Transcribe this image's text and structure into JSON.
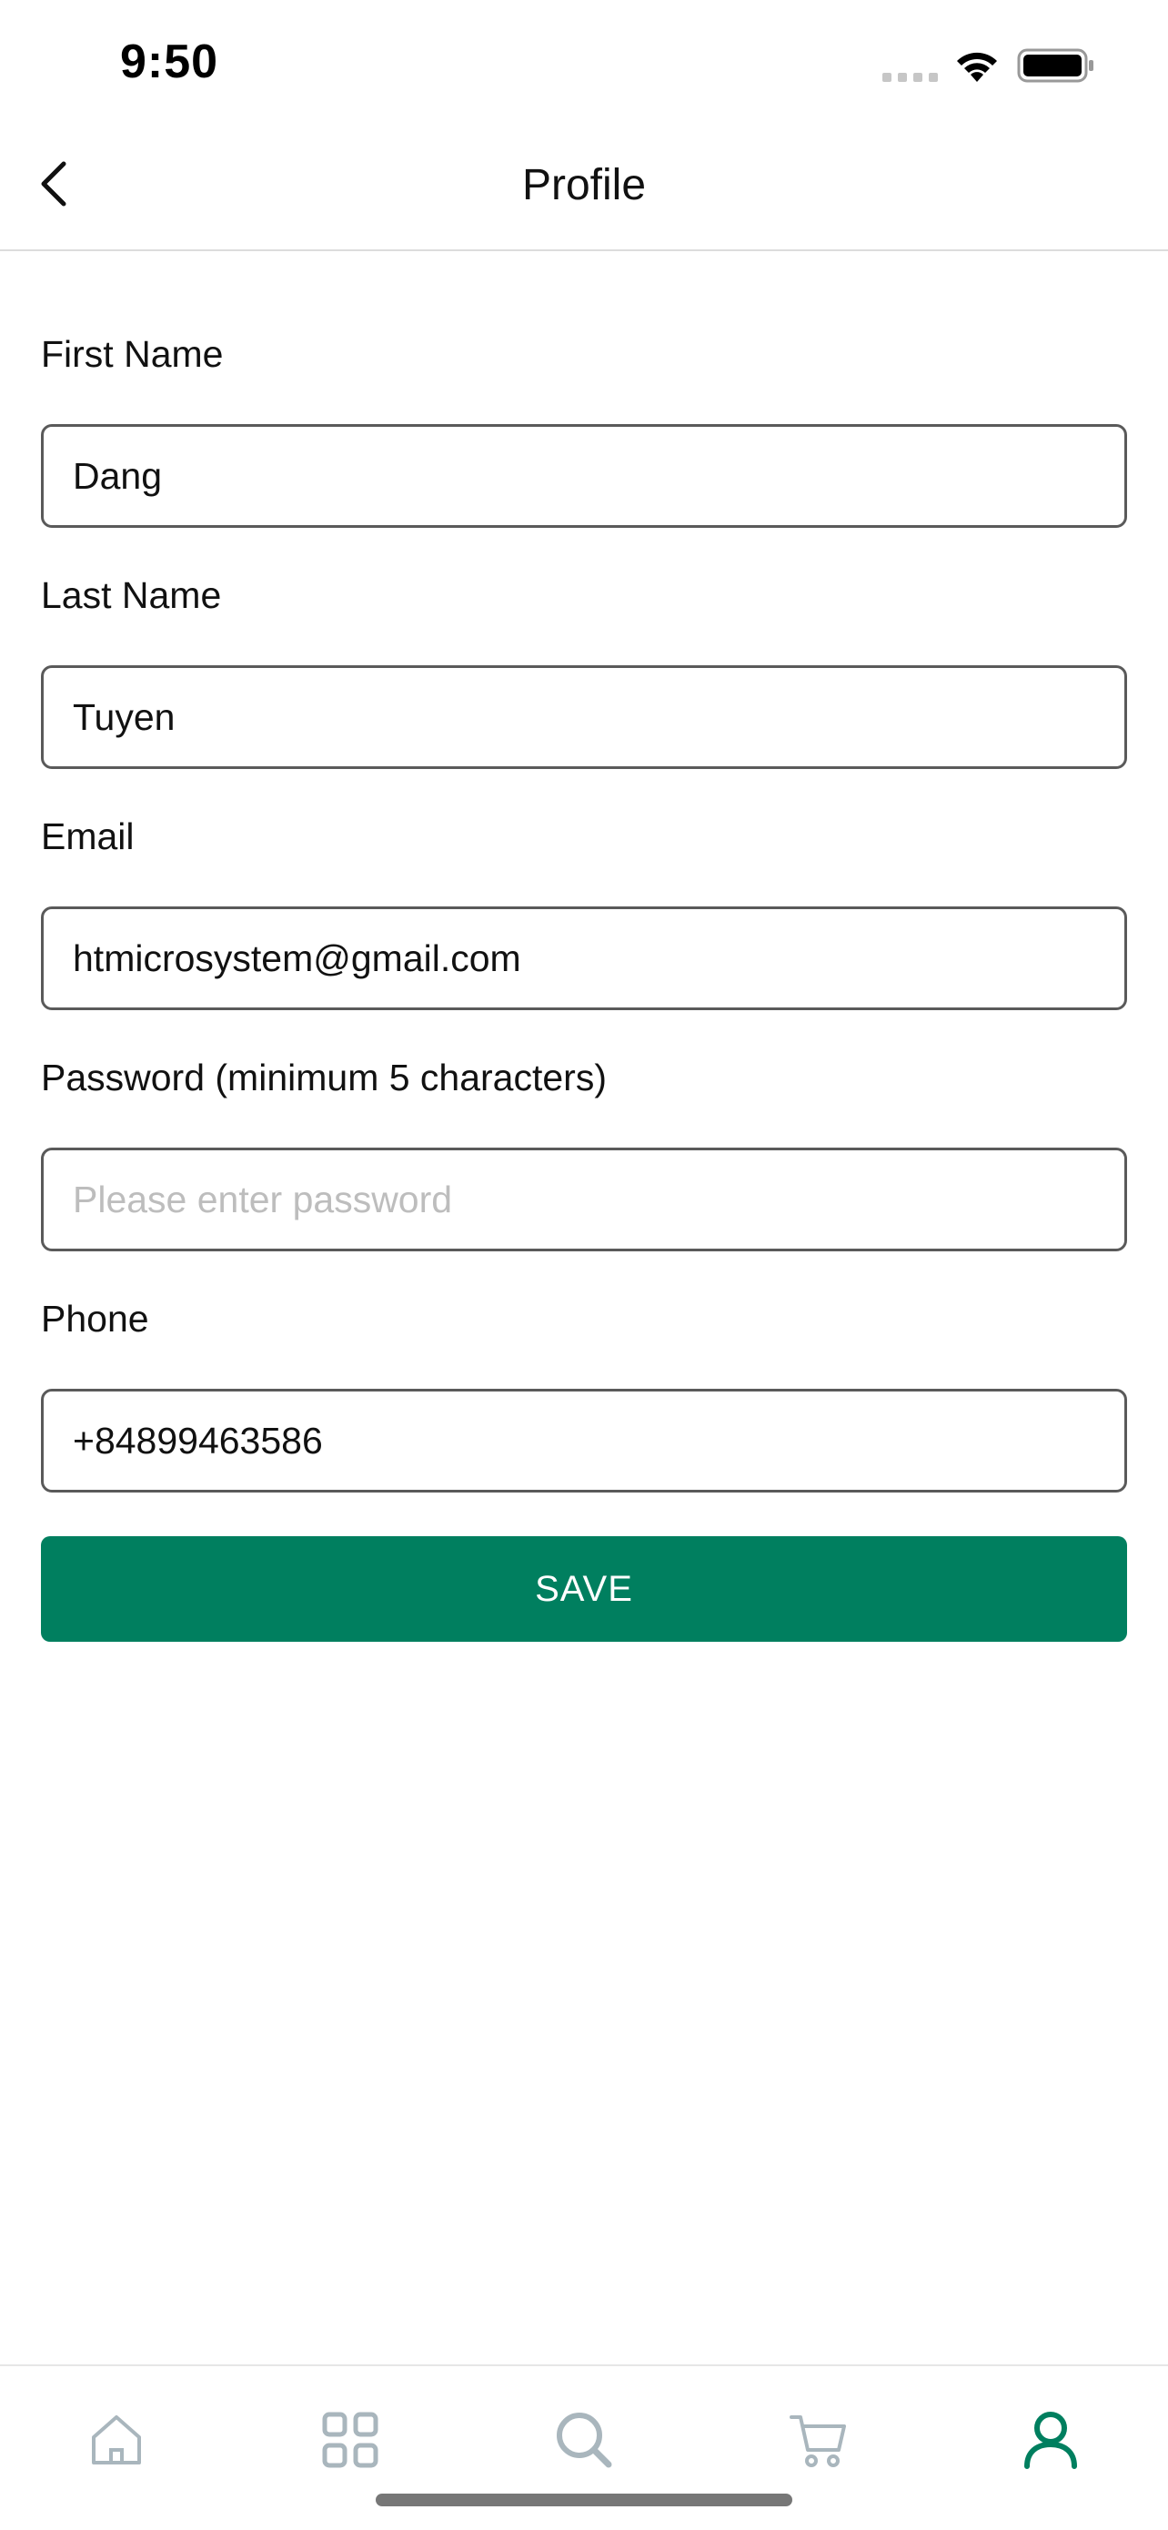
{
  "status_bar": {
    "time": "9:50",
    "icons": [
      "cellular-signal-icon",
      "wifi-icon",
      "battery-icon"
    ]
  },
  "header": {
    "title": "Profile",
    "back_icon": "chevron-left-icon"
  },
  "form": {
    "first_name": {
      "label": "First Name",
      "value": "Dang",
      "placeholder": ""
    },
    "last_name": {
      "label": "Last Name",
      "value": "Tuyen",
      "placeholder": ""
    },
    "email": {
      "label": "Email",
      "value": "htmicrosystem@gmail.com",
      "placeholder": ""
    },
    "password": {
      "label": "Password (minimum 5 characters)",
      "value": "",
      "placeholder": "Please enter password"
    },
    "phone": {
      "label": "Phone",
      "value": "+84899463586",
      "placeholder": ""
    },
    "save_label": "SAVE"
  },
  "tab_bar": {
    "items": [
      {
        "icon": "home-icon",
        "active": false
      },
      {
        "icon": "grid-icon",
        "active": false
      },
      {
        "icon": "search-icon",
        "active": false
      },
      {
        "icon": "cart-icon",
        "active": false
      },
      {
        "icon": "user-icon",
        "active": true
      }
    ]
  },
  "colors": {
    "accent": "#007f5f",
    "inactive_icon": "#a9b6bd",
    "input_border": "#5a5a5a",
    "placeholder": "#bdbdbd"
  }
}
